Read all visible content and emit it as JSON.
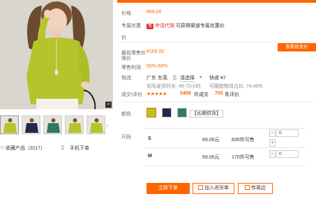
{
  "left": {
    "zoom_icon": "magnifier-icon",
    "thumb_arrow": "›",
    "favorite_label": "收藏产品（3117）",
    "mobile_order_label": "手机下单"
  },
  "info": {
    "price_label": "价格",
    "price_value": "¥69.00",
    "discount_label": "专属优惠",
    "discount_badge": "专",
    "discount_apply": "申请代理",
    "discount_desc": "可获得渠道专属优惠价",
    "discount_suffix": "价",
    "min_retail_label": "最低零售价",
    "min_retail_label_2": "限价",
    "min_retail_value": "¥109.00",
    "retail_profit_label": "零售利润",
    "retail_profit_value": "50%-60%",
    "wholesale_button": "查看批发价",
    "logistics_label": "物流",
    "logistics_from": "广东 东莞",
    "logistics_to_word": "至",
    "logistics_dest": "请选择",
    "logistics_express": "快递 ¥7",
    "ship_time": "实际发货时长: 48-72小时",
    "ship_rate": "可跟踪物流占比: 74.40%",
    "deals_label": "成交\\评价",
    "stars": "★★★★★",
    "deals_count": "5409",
    "deals_unit": "件成交",
    "reviews_count": "703",
    "reviews_unit": "条评价"
  },
  "variants": {
    "color_label": "颜色",
    "long_supply": "【长期供货】",
    "size_label": "尺码",
    "rows": [
      {
        "size": "S",
        "price": "69.00元",
        "stock": "835件可售",
        "qty": "0"
      },
      {
        "size": "M",
        "price": "69.00元",
        "stock": "170件可售",
        "qty": "0"
      }
    ]
  },
  "actions": {
    "order": "立即下单",
    "cart": "加入进货单",
    "share": "传周边"
  },
  "colors": {
    "accent": "#ff6600",
    "garment": "#b5c42a"
  }
}
